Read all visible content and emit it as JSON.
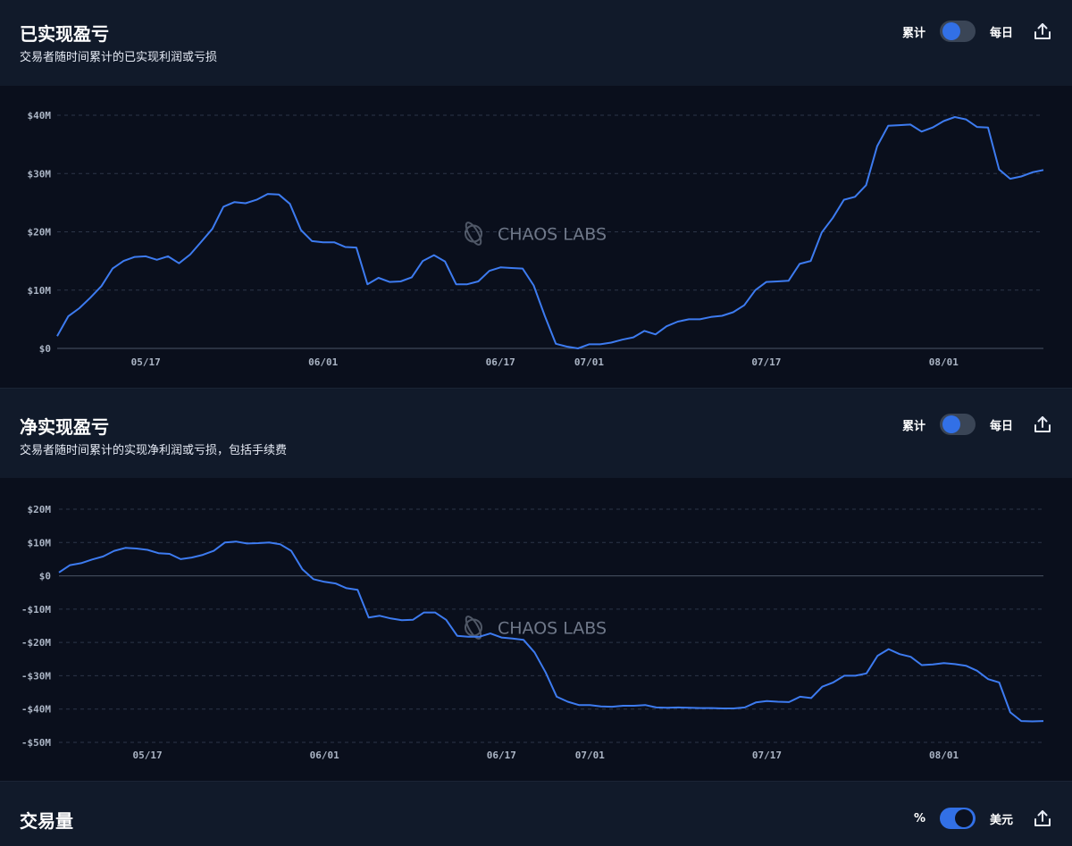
{
  "panels": [
    {
      "title": "已实现盈亏",
      "subtitle": "交易者随时间累计的已实现利润或亏损",
      "toggle_left": "累计",
      "toggle_right": "每日"
    },
    {
      "title": "净实现盈亏",
      "subtitle": "交易者随时间累计的实现净利润或亏损，包括手续费",
      "toggle_left": "累计",
      "toggle_right": "每日"
    },
    {
      "title": "交易量",
      "subtitle": "",
      "toggle_left": "%",
      "toggle_right": "美元"
    }
  ],
  "watermark": "CHAOS LABS",
  "colors": {
    "line": "#3d7bf0",
    "accent": "#3270e6"
  },
  "chart_data": [
    {
      "type": "line",
      "title": "已实现盈亏",
      "ylim": [
        0,
        40
      ],
      "yticks": [
        0,
        10,
        20,
        30,
        40
      ],
      "ytick_labels": [
        "$0",
        "$10M",
        "$20M",
        "$30M",
        "$40M"
      ],
      "x_tick_positions": [
        8,
        24,
        40,
        48,
        64,
        80
      ],
      "x_tick_labels": [
        "05/17",
        "06/01",
        "06/17",
        "07/01",
        "07/17",
        "08/01"
      ],
      "grid": true,
      "x": [
        0,
        1,
        2,
        3,
        4,
        5,
        6,
        7,
        8,
        9,
        10,
        11,
        12,
        13,
        14,
        15,
        16,
        17,
        18,
        19,
        20,
        21,
        22,
        23,
        24,
        25,
        26,
        27,
        28,
        29,
        30,
        31,
        32,
        33,
        34,
        35,
        36,
        37,
        38,
        39,
        40,
        41,
        42,
        43,
        44,
        45,
        46,
        47,
        48,
        49,
        50,
        51,
        52,
        53,
        54,
        55,
        56,
        57,
        58,
        59,
        60,
        61,
        62,
        63,
        64,
        65,
        66,
        67,
        68,
        69,
        70,
        71,
        72,
        73,
        74,
        75,
        76,
        77,
        78,
        79,
        80,
        81,
        82,
        83,
        84,
        85,
        86,
        87,
        88,
        89
      ],
      "series": [
        {
          "values": [
            2.1,
            5.5,
            6.9,
            8.7,
            10.7,
            13.7,
            15.0,
            15.7,
            15.8,
            15.2,
            15.8,
            14.6,
            16.1,
            18.3,
            20.5,
            24.3,
            25.1,
            24.9,
            25.5,
            26.5,
            26.4,
            24.8,
            20.3,
            18.4,
            18.2,
            18.2,
            17.4,
            17.3,
            11.0,
            12.1,
            11.4,
            11.5,
            12.2,
            15.0,
            16.0,
            14.9,
            11.0,
            11.0,
            11.5,
            13.3,
            13.9,
            13.8,
            13.7,
            10.8,
            5.6,
            0.8,
            0.3,
            0.0,
            0.7,
            0.7,
            1.0,
            1.5,
            1.9,
            3.0,
            2.4,
            3.8,
            4.6,
            5.0,
            5.0,
            5.4,
            5.6,
            6.2,
            7.4,
            10.0,
            11.4,
            11.5,
            11.6,
            14.5,
            15.0,
            19.9,
            22.4,
            25.5,
            26.0,
            28.0,
            34.7,
            38.2,
            38.3,
            38.4,
            37.2,
            37.9,
            39.0,
            39.7,
            39.3,
            38.0,
            37.9,
            30.7,
            29.1,
            29.5,
            30.2,
            30.6
          ]
        }
      ]
    },
    {
      "type": "line",
      "title": "净实现盈亏",
      "ylim": [
        -50,
        20
      ],
      "yticks": [
        -50,
        -40,
        -30,
        -20,
        -10,
        0,
        10,
        20
      ],
      "ytick_labels": [
        "-$50M",
        "-$40M",
        "-$30M",
        "-$20M",
        "-$10M",
        "$0",
        "$10M",
        "$20M"
      ],
      "x_tick_positions": [
        8,
        24,
        40,
        48,
        64,
        80
      ],
      "x_tick_labels": [
        "05/17",
        "06/01",
        "06/17",
        "07/01",
        "07/17",
        "08/01"
      ],
      "grid": true,
      "x": [
        0,
        1,
        2,
        3,
        4,
        5,
        6,
        7,
        8,
        9,
        10,
        11,
        12,
        13,
        14,
        15,
        16,
        17,
        18,
        19,
        20,
        21,
        22,
        23,
        24,
        25,
        26,
        27,
        28,
        29,
        30,
        31,
        32,
        33,
        34,
        35,
        36,
        37,
        38,
        39,
        40,
        41,
        42,
        43,
        44,
        45,
        46,
        47,
        48,
        49,
        50,
        51,
        52,
        53,
        54,
        55,
        56,
        57,
        58,
        59,
        60,
        61,
        62,
        63,
        64,
        65,
        66,
        67,
        68,
        69,
        70,
        71,
        72,
        73,
        74,
        75,
        76,
        77,
        78,
        79,
        80,
        81,
        82,
        83,
        84,
        85,
        86,
        87,
        88,
        89
      ],
      "series": [
        {
          "values": [
            1.0,
            3.2,
            3.8,
            4.9,
            5.8,
            7.5,
            8.4,
            8.2,
            7.8,
            6.8,
            6.6,
            5.0,
            5.5,
            6.3,
            7.5,
            10.0,
            10.3,
            9.7,
            9.8,
            10.0,
            9.5,
            7.5,
            2.0,
            -1.0,
            -1.8,
            -2.3,
            -3.7,
            -4.2,
            -12.5,
            -12.0,
            -12.8,
            -13.3,
            -13.2,
            -11.0,
            -11.0,
            -13.2,
            -18.0,
            -18.3,
            -18.3,
            -17.3,
            -18.5,
            -18.8,
            -19.2,
            -23.0,
            -29.0,
            -36.3,
            -37.8,
            -38.8,
            -38.8,
            -39.2,
            -39.3,
            -39.0,
            -39.0,
            -38.8,
            -39.5,
            -39.6,
            -39.5,
            -39.6,
            -39.7,
            -39.7,
            -39.8,
            -39.8,
            -39.5,
            -38.0,
            -37.6,
            -37.8,
            -37.9,
            -36.3,
            -36.7,
            -33.3,
            -32.0,
            -30.0,
            -30.0,
            -29.3,
            -24.0,
            -22.0,
            -23.5,
            -24.3,
            -26.8,
            -26.6,
            -26.2,
            -26.5,
            -27.0,
            -28.5,
            -31.0,
            -32.0,
            -41.0,
            -43.6,
            -43.7,
            -43.6
          ]
        }
      ]
    }
  ]
}
